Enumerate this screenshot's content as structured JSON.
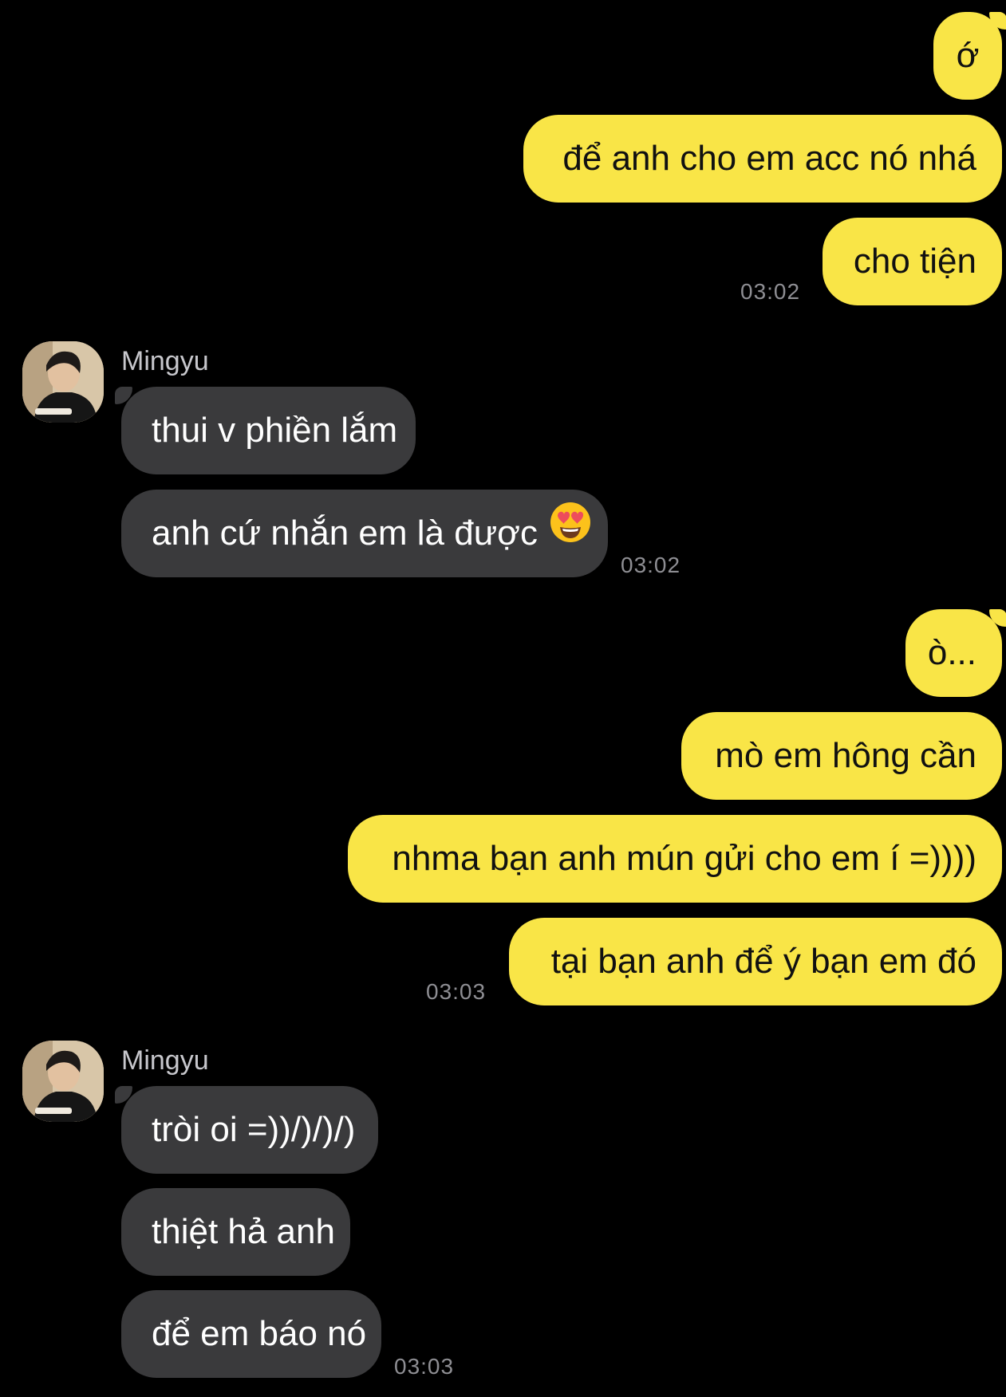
{
  "colors": {
    "background": "#000000",
    "outgoing_bubble": "#f9e547",
    "incoming_bubble": "#3a3a3c",
    "timestamp": "#8e8e93"
  },
  "messages": {
    "group1": {
      "m1": "ớ",
      "m2": "để anh cho em acc nó nhá",
      "m3": "cho tiện",
      "time": "03:02"
    },
    "group2": {
      "sender": "Mingyu",
      "m1": "thui v phiền lắm",
      "m2": "anh cứ nhắn em là được",
      "m2_emoji": "heart-eyes-emoji",
      "time": "03:02"
    },
    "group3": {
      "m1": "ò...",
      "m2": "mò em hông cần",
      "m3": "nhma bạn anh mún gửi cho em í =))))",
      "m4": "tại bạn anh để ý bạn em đó",
      "time": "03:03"
    },
    "group4": {
      "sender": "Mingyu",
      "m1": "tròi oi =))/)/)/)",
      "m2": "thiệt hả anh",
      "m3": "để em báo nó",
      "time": "03:03"
    }
  }
}
